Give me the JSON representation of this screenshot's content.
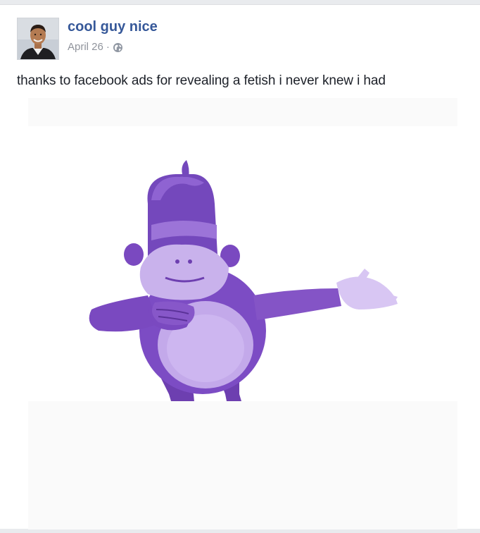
{
  "post": {
    "author": "cool guy nice",
    "date": "April 26",
    "separator": "·",
    "privacy_icon": "globe-icon",
    "text": "thanks to facebook ads for revealing a fetish i never knew i had",
    "image_subject": "purple-gorilla"
  },
  "colors": {
    "author_link": "#365899",
    "meta_gray": "#90949c",
    "text": "#1d2129",
    "gorilla_dark": "#6d3fb0",
    "gorilla_mid": "#8757c9",
    "gorilla_light": "#c9b2ec"
  }
}
